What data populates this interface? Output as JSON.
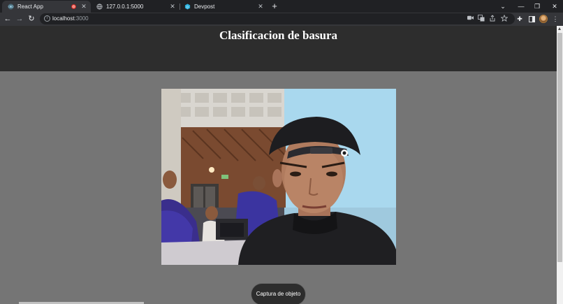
{
  "browser": {
    "tabs": [
      {
        "title": "React App",
        "active": true,
        "recording": true
      },
      {
        "title": "127.0.0.1:5000",
        "active": false
      },
      {
        "title": "Devpost",
        "active": false
      }
    ],
    "address": {
      "host": "localhost",
      "port": ":3000"
    },
    "icons": {
      "new_tab": "+",
      "minimize": "—",
      "restore": "❐",
      "close": "✕",
      "tab_list": "⌄",
      "back": "←",
      "forward": "→",
      "reload": "↻",
      "info": "i",
      "extensions": "✚",
      "menu": "⋮"
    }
  },
  "page": {
    "title": "Clasificacion de basura",
    "capture_button": "Captura de objeto",
    "webcam_alt": "Webcam feed"
  },
  "colors": {
    "header_bg": "#2d2d2d",
    "page_bg": "#757575",
    "title_text": "#ffffff",
    "browser_frame": "#202124",
    "toolbar_bg": "#35363a"
  }
}
